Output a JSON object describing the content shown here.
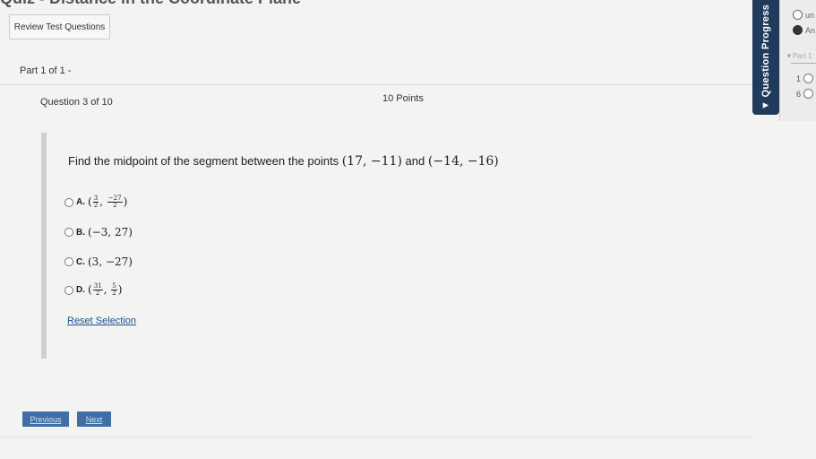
{
  "header": {
    "title": "Quiz - Distance in the Coordinate Plane"
  },
  "toolbar": {
    "review_label": "Review Test Questions"
  },
  "part": {
    "label": "Part 1 of 1 -"
  },
  "question": {
    "number_label": "Question 3 of 10",
    "points_label": "10 Points",
    "prompt_text": "Find the midpoint of the segment between the points",
    "point1": "(17, −11)",
    "and_text": "and",
    "point2": "(−14, −16)",
    "choices": [
      {
        "letter": "A.",
        "parts": [
          "3",
          "2",
          "−27",
          "2"
        ]
      },
      {
        "letter": "B.",
        "text": "(−3, 27)"
      },
      {
        "letter": "C.",
        "text": "(3, −27)"
      },
      {
        "letter": "D.",
        "parts": [
          "31",
          "2",
          "5",
          "2"
        ]
      }
    ],
    "reset_label": "Reset Selection"
  },
  "nav": {
    "previous_label": "Previous",
    "next_label": "Next"
  },
  "progress_panel": {
    "tab_label": "▼ Question Progress",
    "legend": [
      {
        "label": "un",
        "filled": false
      },
      {
        "label": "An",
        "filled": true
      }
    ],
    "part_label": "▼Part 1:",
    "rows": [
      "1",
      "6"
    ]
  }
}
